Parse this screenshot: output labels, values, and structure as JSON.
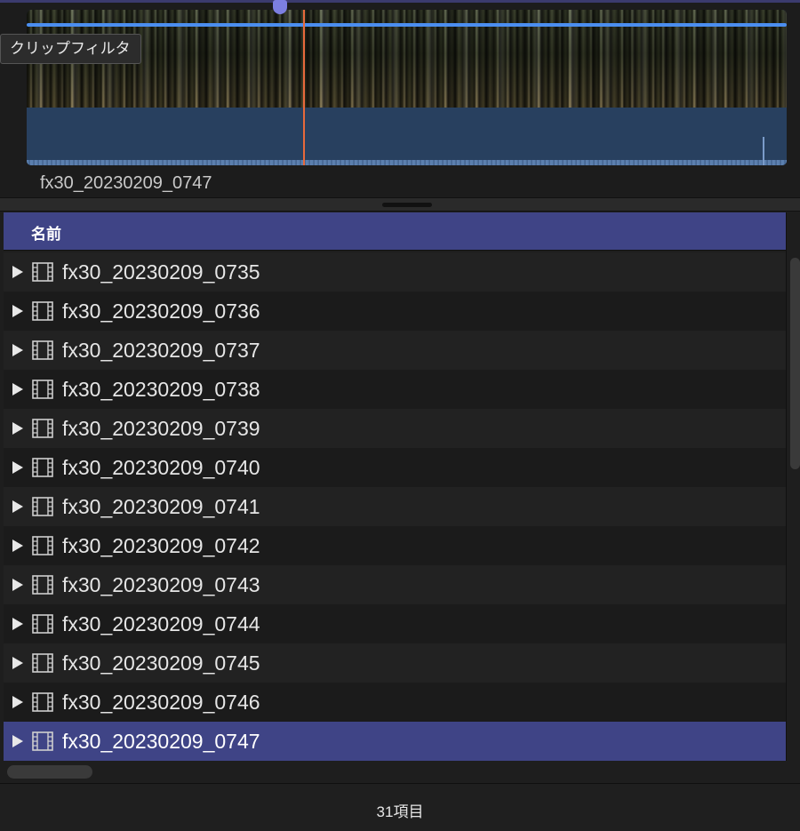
{
  "viewer": {
    "tooltip": "クリップフィルタ",
    "clip_name": "fx30_20230209_0747"
  },
  "browser": {
    "column_header": "名前",
    "rows": [
      {
        "label": "fx30_20230209_0735",
        "selected": false
      },
      {
        "label": "fx30_20230209_0736",
        "selected": false
      },
      {
        "label": "fx30_20230209_0737",
        "selected": false
      },
      {
        "label": "fx30_20230209_0738",
        "selected": false
      },
      {
        "label": "fx30_20230209_0739",
        "selected": false
      },
      {
        "label": "fx30_20230209_0740",
        "selected": false
      },
      {
        "label": "fx30_20230209_0741",
        "selected": false
      },
      {
        "label": "fx30_20230209_0742",
        "selected": false
      },
      {
        "label": "fx30_20230209_0743",
        "selected": false
      },
      {
        "label": "fx30_20230209_0744",
        "selected": false
      },
      {
        "label": "fx30_20230209_0745",
        "selected": false
      },
      {
        "label": "fx30_20230209_0746",
        "selected": false
      },
      {
        "label": "fx30_20230209_0747",
        "selected": true
      }
    ],
    "item_count": "31項目"
  },
  "colors": {
    "selection": "#3f4486",
    "range_line": "#4b8ef0",
    "playhead": "#e8693b",
    "audio": "#28405f"
  },
  "icons": {
    "disclosure": "disclosure-triangle-icon",
    "clip": "film-clip-icon"
  }
}
